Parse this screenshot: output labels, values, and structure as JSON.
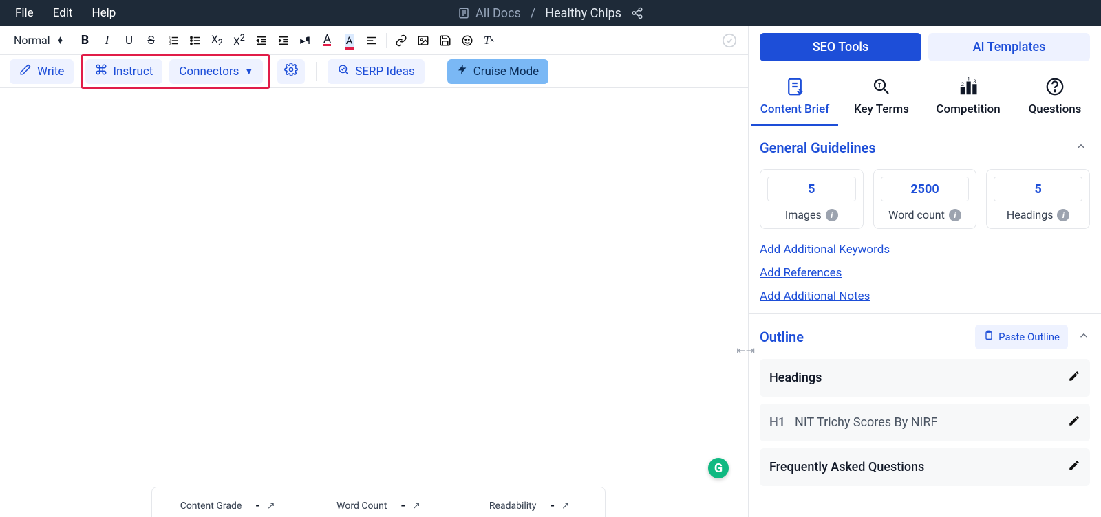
{
  "menu": {
    "file": "File",
    "edit": "Edit",
    "help": "Help"
  },
  "breadcrumb": {
    "all_docs": "All Docs",
    "doc_name": "Healthy Chips"
  },
  "format_bar": {
    "block_style": "Normal"
  },
  "action_bar": {
    "write": "Write",
    "instruct": "Instruct",
    "connectors": "Connectors",
    "serp_ideas": "SERP Ideas",
    "cruise_mode": "Cruise Mode"
  },
  "sidebar_tabs": {
    "seo_tools": "SEO Tools",
    "ai_templates": "AI Templates"
  },
  "sub_tabs": {
    "content_brief": "Content Brief",
    "key_terms": "Key Terms",
    "competition": "Competition",
    "questions": "Questions"
  },
  "guidelines": {
    "title": "General Guidelines",
    "images": {
      "value": "5",
      "label": "Images"
    },
    "word_count": {
      "value": "2500",
      "label": "Word count"
    },
    "headings": {
      "value": "5",
      "label": "Headings"
    }
  },
  "links": {
    "add_keywords": "Add Additional Keywords",
    "add_refs": "Add References",
    "add_notes": "Add Additional Notes"
  },
  "outline": {
    "title": "Outline",
    "paste_btn": "Paste Outline",
    "items": [
      {
        "tag": "",
        "title": "Headings",
        "class": "headings"
      },
      {
        "tag": "H1",
        "title": "NIT Trichy Scores By NIRF",
        "class": ""
      },
      {
        "tag": "",
        "title": "Frequently Asked Questions",
        "class": "headings"
      }
    ]
  },
  "score_panel": {
    "content_grade": {
      "label": "Content Grade",
      "value": "-"
    },
    "word_count": {
      "label": "Word Count",
      "value": "-"
    },
    "readability": {
      "label": "Readability",
      "value": "-"
    }
  },
  "badge": "G"
}
